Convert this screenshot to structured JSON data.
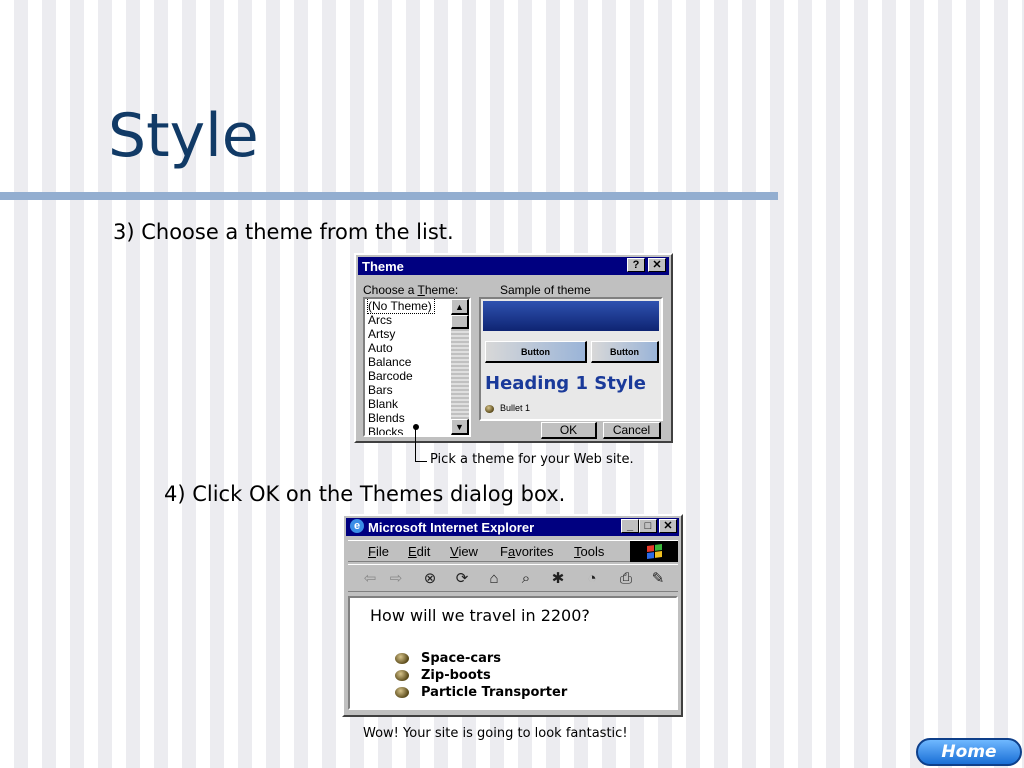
{
  "slide": {
    "title": "Style",
    "step3": "3) Choose a theme from the list.",
    "step4": "4) Click OK on the Themes dialog box.",
    "caption_theme": "Pick a theme for your Web site.",
    "caption_ie": "Wow! Your site is going to look fantastic!",
    "home_label": "Home"
  },
  "theme_dialog": {
    "title": "Theme",
    "help_btn": "?",
    "close_btn": "✕",
    "choose_label_pre": "Choose a ",
    "choose_label_u": "T",
    "choose_label_post": "heme:",
    "sample_label": "Sample of theme",
    "themes": [
      "(No Theme)",
      "Arcs",
      "Artsy",
      "Auto",
      "Balance",
      "Barcode",
      "Bars",
      "Blank",
      "Blends",
      "Blocks"
    ],
    "preview_button": "Button",
    "preview_heading": "Heading 1 Style",
    "preview_bullet": "Bullet 1",
    "ok": "OK",
    "cancel": "Cancel"
  },
  "ie_window": {
    "title": "Microsoft Internet Explorer",
    "menu": [
      {
        "u": "F",
        "rest": "ile"
      },
      {
        "u": "E",
        "rest": "dit"
      },
      {
        "u": "V",
        "rest": "iew"
      },
      {
        "pre": "F",
        "u": "a",
        "rest": "vorites"
      },
      {
        "u": "T",
        "rest": "ools"
      }
    ],
    "page_heading": "How will we travel in 2200?",
    "bullets": [
      "Space-cars",
      "Zip-boots",
      "Particle Transporter"
    ]
  }
}
